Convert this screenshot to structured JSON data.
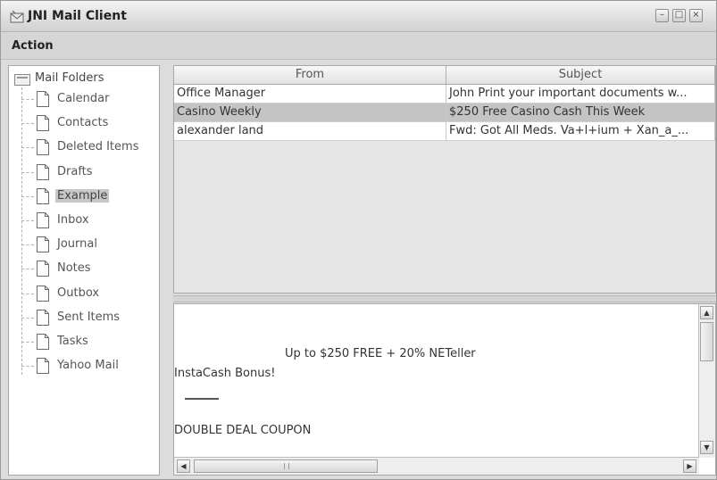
{
  "window": {
    "title": "JNI Mail Client",
    "minimize_glyph": "–",
    "maximize_glyph": "□",
    "close_glyph": "×"
  },
  "menubar": {
    "items": [
      {
        "label": "Action"
      }
    ]
  },
  "folders": {
    "root_label": "Mail Folders",
    "items": [
      {
        "label": "Calendar"
      },
      {
        "label": "Contacts"
      },
      {
        "label": "Deleted Items"
      },
      {
        "label": "Drafts"
      },
      {
        "label": "Example"
      },
      {
        "label": "Inbox"
      },
      {
        "label": "Journal"
      },
      {
        "label": "Notes"
      },
      {
        "label": "Outbox"
      },
      {
        "label": "Sent Items"
      },
      {
        "label": "Tasks"
      },
      {
        "label": "Yahoo Mail"
      }
    ],
    "selected": "Example"
  },
  "messages": {
    "columns": [
      {
        "label": "From"
      },
      {
        "label": "Subject"
      }
    ],
    "rows": [
      {
        "from": "Office Manager",
        "subject": "John Print your important documents w..."
      },
      {
        "from": "Casino Weekly",
        "subject": "$250 Free Casino Cash This Week"
      },
      {
        "from": "alexander land",
        "subject": "Fwd: Got All Meds. Va+l+ium + Xan_a_..."
      }
    ],
    "selected_row": 1
  },
  "preview": {
    "line1": "Up to $250 FREE + 20% NETeller",
    "line2": "InstaCash Bonus!",
    "line3": "DOUBLE DEAL COUPON"
  },
  "icons": {
    "app": "envelope-app-icon",
    "root": "mail-folders-icon",
    "folder": "document-icon",
    "scroll_up": "▲",
    "scroll_down": "▼",
    "scroll_left": "◀",
    "scroll_right": "▶"
  },
  "colors": {
    "selection": "#c4c4c4",
    "window_bg": "#dcdcdc"
  }
}
